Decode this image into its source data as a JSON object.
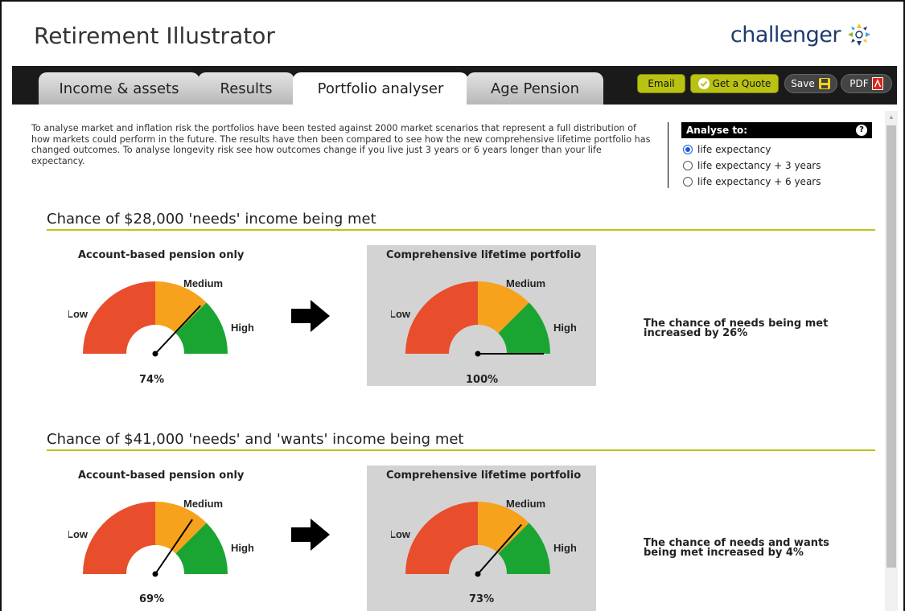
{
  "app": {
    "title": "Retirement Illustrator",
    "brand": "challenger"
  },
  "tabs": [
    {
      "label": "Income & assets",
      "active": false
    },
    {
      "label": "Results",
      "active": false
    },
    {
      "label": "Portfolio analyser",
      "active": true
    },
    {
      "label": "Age Pension",
      "active": false
    }
  ],
  "toolbar": {
    "email": "Email",
    "quote": "Get a Quote",
    "save": "Save",
    "pdf": "PDF"
  },
  "intro": "To analyse market and inflation risk the portfolios have been tested against 2000 market scenarios that represent a full distribution of how markets could perform in the future. The results have then been compared to see how the new comprehensive lifetime portfolio has changed outcomes. To analyse longevity risk see how outcomes change if you live just 3 years or 6 years longer than your life expectancy.",
  "analyse": {
    "heading": "Analyse to:",
    "help": "?",
    "options": [
      {
        "label": "life expectancy",
        "checked": true
      },
      {
        "label": "life expectancy + 3 years",
        "checked": false
      },
      {
        "label": "life expectancy + 6 years",
        "checked": false
      }
    ]
  },
  "gauge_labels": {
    "low": "Low",
    "medium": "Medium",
    "high": "High"
  },
  "colors": {
    "low": "#e84e2c",
    "medium": "#f6a21d",
    "high": "#1aa532",
    "accent": "#bcc41c"
  },
  "sections": [
    {
      "title": "Chance of $28,000 'needs' income being met",
      "left_label": "Account-based pension only",
      "right_label": "Comprehensive lifetime portfolio",
      "left_value": 74,
      "right_value": 100,
      "left_pct": "74%",
      "right_pct": "100%",
      "result_line1": "The chance of needs being met",
      "result_line2": "increased by 26%"
    },
    {
      "title": "Chance of $41,000 'needs' and 'wants' income being met",
      "left_label": "Account-based pension only",
      "right_label": "Comprehensive lifetime portfolio",
      "left_value": 69,
      "right_value": 73,
      "left_pct": "69%",
      "right_pct": "73%",
      "result_line1": "The chance of needs and wants",
      "result_line2": "being met increased by 4%"
    }
  ]
}
